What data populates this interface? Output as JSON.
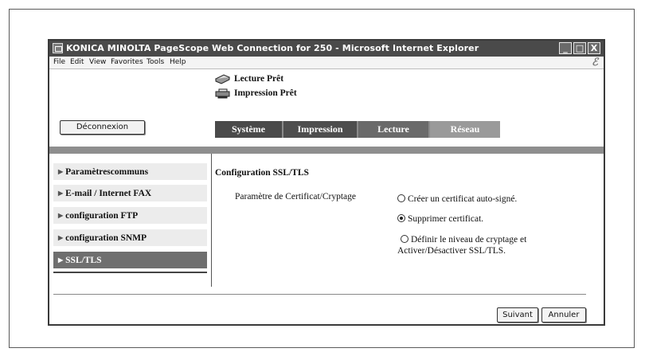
{
  "window": {
    "title": "KONICA MINOLTA PageScope Web Connection for 250 - Microsoft Internet Explorer",
    "controls": {
      "minimize": "_",
      "maximize": "□",
      "close": "X"
    }
  },
  "menubar": {
    "items": [
      "File",
      "Edit",
      "View",
      "Favorites",
      "Tools",
      "Help"
    ]
  },
  "status": {
    "scan": "Lecture Prêt",
    "print": "Impression Prêt"
  },
  "logout_label": "Déconnexion",
  "tabs": [
    "Système",
    "Impression",
    "Lecture",
    "Réseau"
  ],
  "sidebar": {
    "items": [
      {
        "label": "Paramètrescommuns",
        "active": false
      },
      {
        "label": "E-mail / Internet FAX",
        "active": false
      },
      {
        "label": "configuration FTP",
        "active": false
      },
      {
        "label": "configuration SNMP",
        "active": false
      },
      {
        "label": "SSL/TLS",
        "active": true
      }
    ]
  },
  "main": {
    "section_title": "Configuration SSL/TLS",
    "param_label": "Paramètre de Certificat/Cryptage",
    "options": [
      {
        "label": "Créer un certificat auto-signé.",
        "checked": false
      },
      {
        "label": "Supprimer certificat.",
        "checked": true
      },
      {
        "label": "Définir le niveau de cryptage et",
        "label_cont": "Activer/Désactiver SSL/TLS.",
        "checked": false
      }
    ]
  },
  "buttons": {
    "next": "Suivant",
    "cancel": "Annuler"
  }
}
